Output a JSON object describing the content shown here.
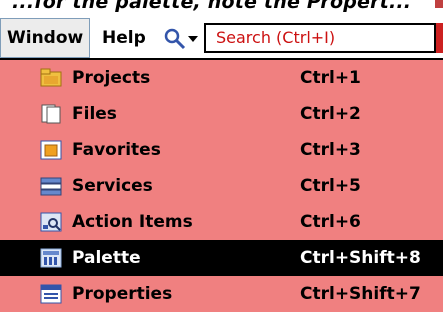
{
  "top_cut_text": "...for the palette, note the Propert...",
  "menubar": {
    "window_label": "Window",
    "help_label": "Help",
    "search_placeholder": "Search (Ctrl+I)"
  },
  "menu": {
    "items": [
      {
        "label": "Projects",
        "shortcut": "Ctrl+1",
        "icon": "projects-folder-icon"
      },
      {
        "label": "Files",
        "shortcut": "Ctrl+2",
        "icon": "files-icon"
      },
      {
        "label": "Favorites",
        "shortcut": "Ctrl+3",
        "icon": "favorites-icon"
      },
      {
        "label": "Services",
        "shortcut": "Ctrl+5",
        "icon": "services-icon"
      },
      {
        "label": "Action Items",
        "shortcut": "Ctrl+6",
        "icon": "action-items-icon"
      },
      {
        "label": "Palette",
        "shortcut": "Ctrl+Shift+8",
        "icon": "palette-icon",
        "selected": true
      },
      {
        "label": "Properties",
        "shortcut": "Ctrl+Shift+7",
        "icon": "properties-icon"
      }
    ]
  },
  "colors": {
    "menu_background": "#f08080",
    "selected_background": "#000000",
    "search_text": "#cc1111"
  }
}
